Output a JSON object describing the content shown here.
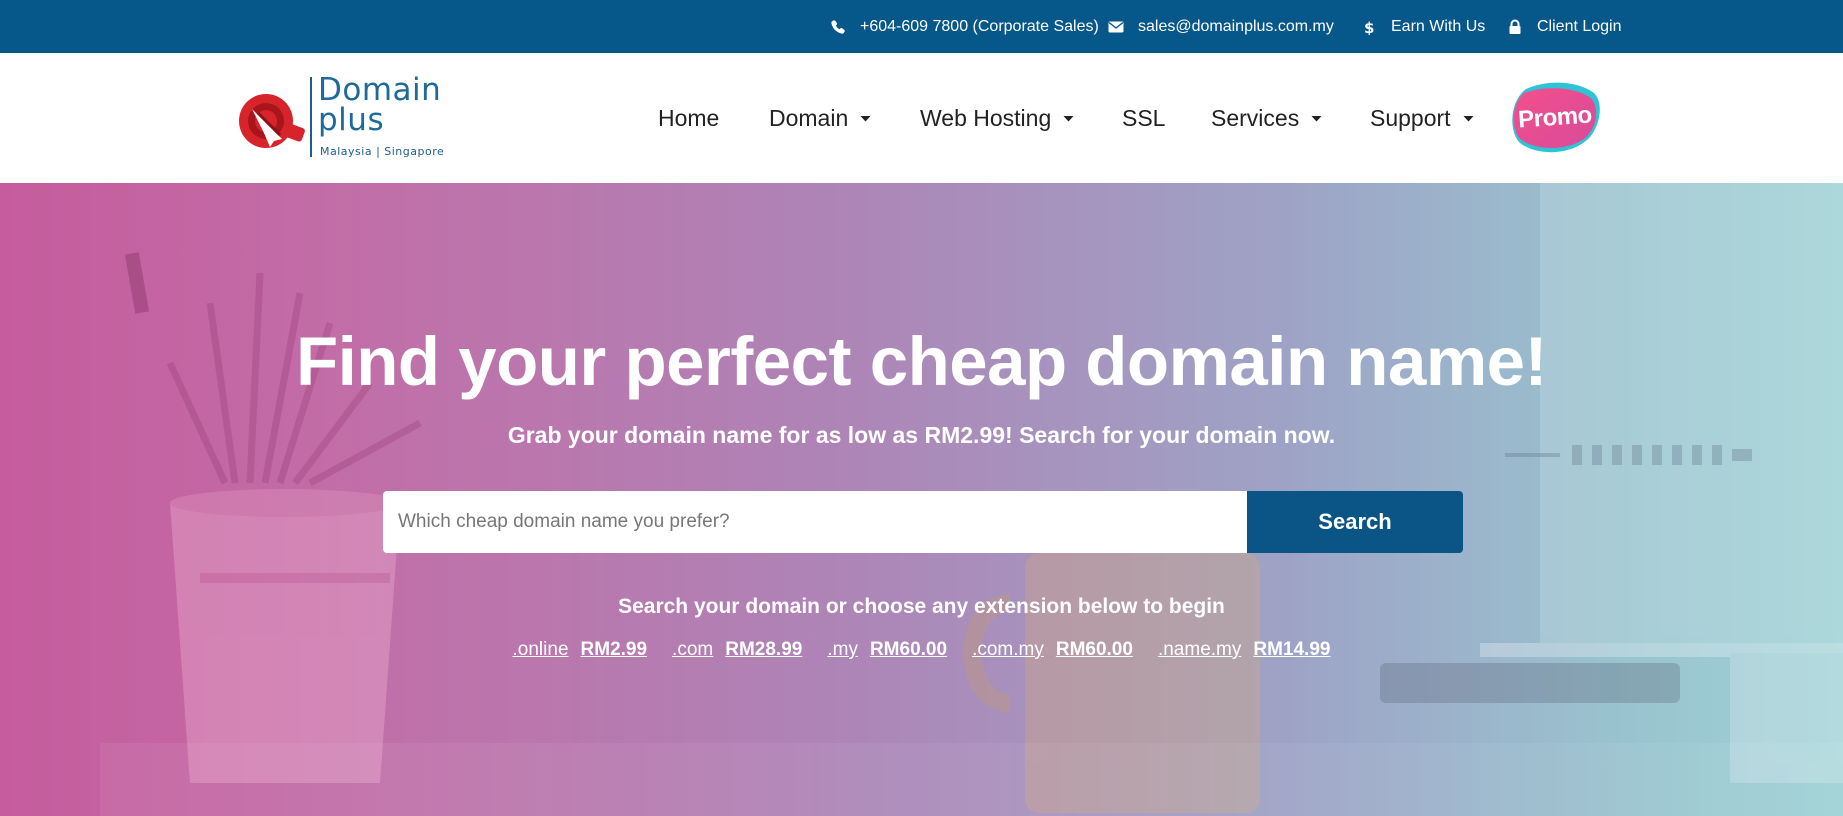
{
  "topbar": {
    "phone": "+604-609 7800 (Corporate Sales)",
    "email": "sales@domainplus.com.my",
    "earn": "Earn With Us",
    "login": "Client Login",
    "icons": [
      "phone-icon",
      "envelope-icon",
      "dollar-icon",
      "lock-icon"
    ]
  },
  "logo": {
    "line1": "Domain",
    "line2": "plus",
    "tagline": "Malaysia | Singapore"
  },
  "nav": {
    "items": [
      {
        "label": "Home",
        "has_dropdown": false
      },
      {
        "label": "Domain",
        "has_dropdown": true
      },
      {
        "label": "Web Hosting",
        "has_dropdown": true
      },
      {
        "label": "SSL",
        "has_dropdown": false
      },
      {
        "label": "Services",
        "has_dropdown": true
      },
      {
        "label": "Support",
        "has_dropdown": true
      }
    ],
    "promo": "Promo"
  },
  "hero": {
    "title": "Find your perfect cheap domain name!",
    "subtitle": "Grab your domain name for as low as RM2.99! Search for your domain now.",
    "search": {
      "placeholder": "Which cheap domain name you prefer?",
      "value": "",
      "button": "Search"
    },
    "hint": "Search your domain or choose any extension below to begin",
    "extensions": [
      {
        "ext": ".online",
        "price": "RM2.99"
      },
      {
        "ext": ".com",
        "price": "RM28.99"
      },
      {
        "ext": ".my",
        "price": "RM60.00"
      },
      {
        "ext": ".com.my",
        "price": "RM60.00"
      },
      {
        "ext": ".name.my",
        "price": "RM14.99"
      }
    ]
  },
  "colors": {
    "topbar_bg": "#06578a",
    "search_button": "#0a5586",
    "hero_left": "#c65c9d",
    "hero_right": "#9fd2d6",
    "promo_pink": "#e8508a",
    "promo_teal": "#2ec4d6",
    "logo_red": "#d7242a",
    "logo_blue": "#1e6a99"
  }
}
